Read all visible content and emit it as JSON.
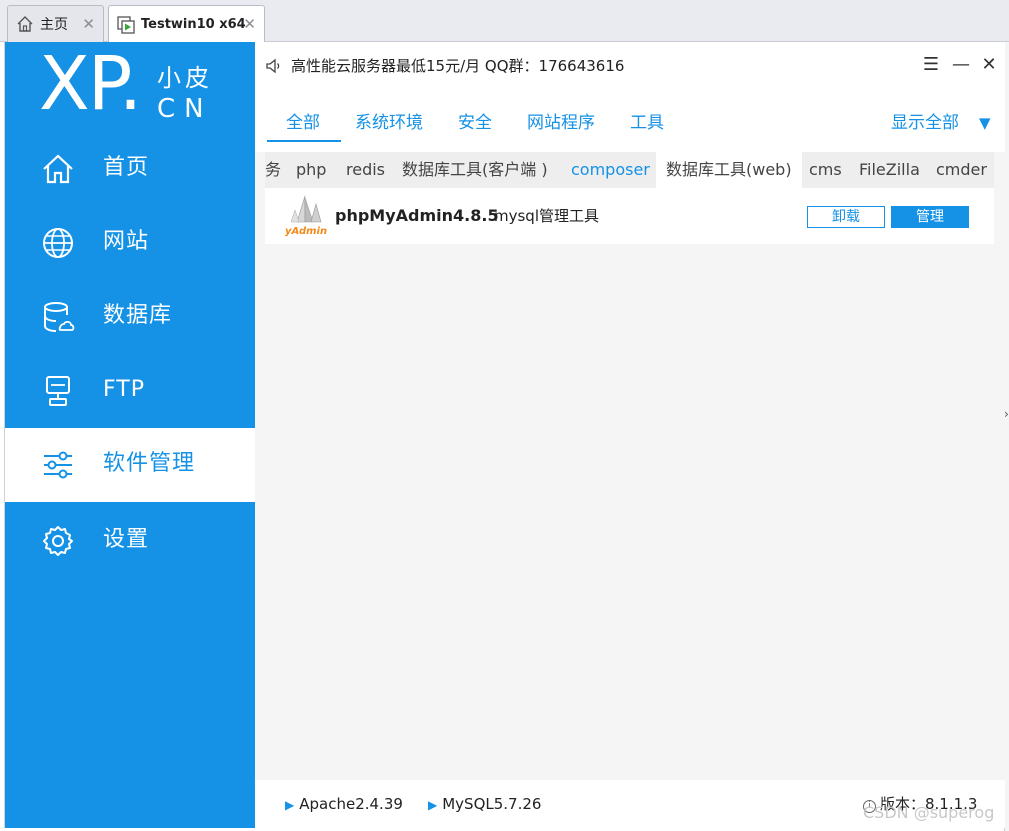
{
  "host_tabs": [
    {
      "label": "主页",
      "icon": "home-icon"
    },
    {
      "label": "Testwin10 x64",
      "icon": "vm-play-icon"
    }
  ],
  "app": {
    "logo": {
      "main": "XP",
      "dot": ".",
      "cn_small": "小皮",
      "latin": "CN"
    },
    "nav": [
      {
        "label": "首页",
        "icon": "home-icon"
      },
      {
        "label": "网站",
        "icon": "globe-icon"
      },
      {
        "label": "数据库",
        "icon": "database-icon"
      },
      {
        "label": "FTP",
        "icon": "ftp-server-icon"
      },
      {
        "label": "软件管理",
        "icon": "sliders-icon",
        "active": true
      },
      {
        "label": "设置",
        "icon": "gear-icon"
      }
    ],
    "notice": "高性能云服务器最低15元/月  QQ群：176643616",
    "categories": [
      {
        "label": "全部",
        "active": true
      },
      {
        "label": "系统环境"
      },
      {
        "label": "安全"
      },
      {
        "label": "网站程序"
      },
      {
        "label": "工具"
      }
    ],
    "show_all": "显示全部",
    "show_all_arrow": "▼",
    "subtabs": [
      {
        "label": "务"
      },
      {
        "label": "php"
      },
      {
        "label": "redis"
      },
      {
        "label": "数据库工具(客户端 )"
      },
      {
        "label": "composer",
        "highlight": true
      },
      {
        "label": "数据库工具(web)",
        "selected": true
      },
      {
        "label": "cms"
      },
      {
        "label": "FileZilla"
      },
      {
        "label": "cmder"
      }
    ],
    "software": {
      "name": "phpMyAdmin4.8.5",
      "desc": "mysql管理工具",
      "logo_text": "yAdmin",
      "uninstall_label": "卸载",
      "manage_label": "管理"
    },
    "footer": {
      "services": [
        {
          "label": "Apache2.4.39"
        },
        {
          "label": "MySQL5.7.26"
        }
      ],
      "version": "版本：8.1.1.3"
    },
    "watermark": "CSDN @superog"
  },
  "colors": {
    "accent": "#1592e6",
    "sidebar_bg": "#1592e6",
    "content_bg": "#f5f5f5"
  }
}
